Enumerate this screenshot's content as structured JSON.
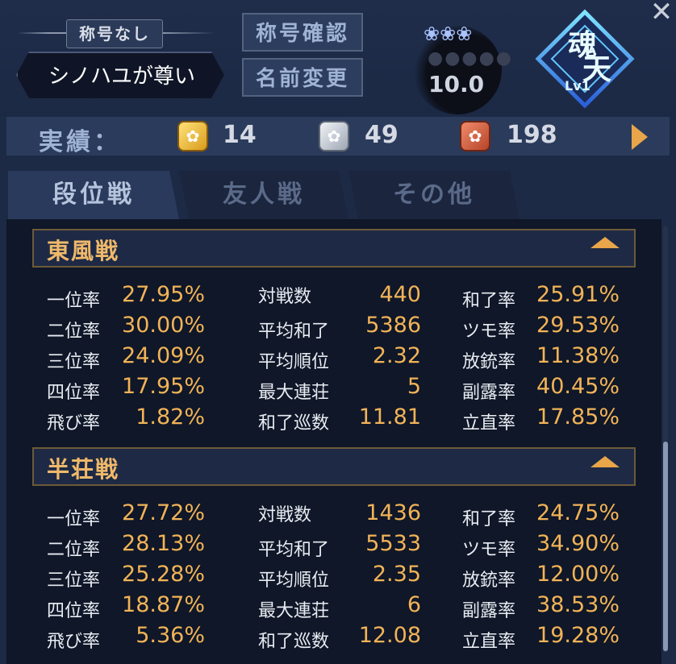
{
  "header": {
    "title_badge": "称号なし",
    "player_name": "シノハユが尊い",
    "btn_title_confirm": "称号確認",
    "btn_name_change": "名前変更",
    "rank_flowers": "❀❀❀",
    "rank_dots": "●●●●●",
    "rank_score": "10.0",
    "emblem_text": "魂天",
    "emblem_level": "Lv1",
    "close_glyph": "✕"
  },
  "achievements": {
    "label": "実績：",
    "gold_count": "14",
    "silver_count": "49",
    "bronze_count": "198"
  },
  "tabs": [
    {
      "label": "段位戦"
    },
    {
      "label": "友人戦"
    },
    {
      "label": "その他"
    }
  ],
  "sections": [
    {
      "title": "東風戦",
      "rows": [
        {
          "l1": "一位率",
          "v1": "27.95%",
          "l2": "対戦数",
          "v2": "440",
          "l3": "和了率",
          "v3": "25.91%"
        },
        {
          "l1": "二位率",
          "v1": "30.00%",
          "l2": "平均和了",
          "v2": "5386",
          "l3": "ツモ率",
          "v3": "29.53%"
        },
        {
          "l1": "三位率",
          "v1": "24.09%",
          "l2": "平均順位",
          "v2": "2.32",
          "l3": "放銃率",
          "v3": "11.38%"
        },
        {
          "l1": "四位率",
          "v1": "17.95%",
          "l2": "最大連荘",
          "v2": "5",
          "l3": "副露率",
          "v3": "40.45%"
        },
        {
          "l1": "飛び率",
          "v1": "1.82%",
          "l2": "和了巡数",
          "v2": "11.81",
          "l3": "立直率",
          "v3": "17.85%"
        }
      ]
    },
    {
      "title": "半荘戦",
      "rows": [
        {
          "l1": "一位率",
          "v1": "27.72%",
          "l2": "対戦数",
          "v2": "1436",
          "l3": "和了率",
          "v3": "24.75%"
        },
        {
          "l1": "二位率",
          "v1": "28.13%",
          "l2": "平均和了",
          "v2": "5533",
          "l3": "ツモ率",
          "v3": "34.90%"
        },
        {
          "l1": "三位率",
          "v1": "25.28%",
          "l2": "平均順位",
          "v2": "2.35",
          "l3": "放銃率",
          "v3": "12.00%"
        },
        {
          "l1": "四位率",
          "v1": "18.87%",
          "l2": "最大連荘",
          "v2": "6",
          "l3": "副露率",
          "v3": "38.53%"
        },
        {
          "l1": "飛び率",
          "v1": "5.36%",
          "l2": "和了巡数",
          "v2": "12.08",
          "l3": "立直率",
          "v3": "19.28%"
        }
      ]
    }
  ],
  "colors": {
    "accent_orange": "#f2b357",
    "panel_dark": "#0f1728"
  }
}
